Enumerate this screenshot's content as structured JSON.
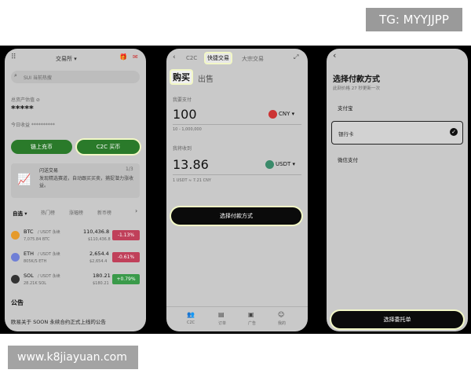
{
  "overlay": {
    "tg": "TG: MYYJJPP",
    "watermark": "www.k8jiayuan.com"
  },
  "p1": {
    "header_title": "交易所 ▾",
    "search_placeholder": "SUI 当前热搜",
    "assets_label": "总资产估值 ⊘",
    "assets_value": "*****",
    "today_label": "今日收益 **********",
    "btn_chain": "链上充币",
    "btn_c2c": "C2C 买币",
    "promo_title": "闪送交易",
    "promo_page": "1/3",
    "promo_desc": "发现精选赛道，自动跟买买卖，捕捉潜力涨收益。",
    "tabs": [
      "自选 ▾",
      "热门榜",
      "涨幅榜",
      "新币榜"
    ],
    "coins": [
      {
        "sym": "BTC",
        "pair": "/ USDT 永续",
        "vol": "7,075.84 BTC",
        "price": "110,436.8",
        "cny": "$110,436.8",
        "chg": "-1.13%",
        "color": "#c0405a",
        "icon": "#e59a2b"
      },
      {
        "sym": "ETH",
        "pair": "/ USDT 永续",
        "vol": "805K/S ETH",
        "price": "2,654.4",
        "cny": "$2,654.4",
        "chg": "-0.61%",
        "color": "#c0405a",
        "icon": "#6f7fd6"
      },
      {
        "sym": "SOL",
        "pair": "/ USDT 永续",
        "vol": "28.21K SOL",
        "price": "180.21",
        "cny": "$180.21",
        "chg": "+0.79%",
        "color": "#3a9a4a",
        "icon": "#333"
      }
    ],
    "ann_title": "公告",
    "ann_text": "欧易关于 SOON 永续合约正式上线的公告"
  },
  "p2": {
    "tabs": [
      "C2C",
      "快捷交易",
      "大宗交易"
    ],
    "buy": "购买",
    "sell": "出售",
    "pay_label": "我要支付",
    "pay_amount": "100",
    "pay_currency": "CNY ▾",
    "pay_hint": "10 - 1,000,000",
    "recv_label": "我将收到",
    "recv_amount": "13.86",
    "recv_currency": "USDT ▾",
    "rate": "1 USDT ≈ 7.21 CNY",
    "select_btn": "选择付款方式",
    "nav": [
      "C2C",
      "订单",
      "广告",
      "我的"
    ]
  },
  "p3": {
    "back": "‹",
    "title": "选择付款方式",
    "subtitle": "此刻价格 27 秒更新一次",
    "options": [
      "支付宝",
      "银行卡",
      "微信支付"
    ],
    "confirm": "选择委托单"
  }
}
